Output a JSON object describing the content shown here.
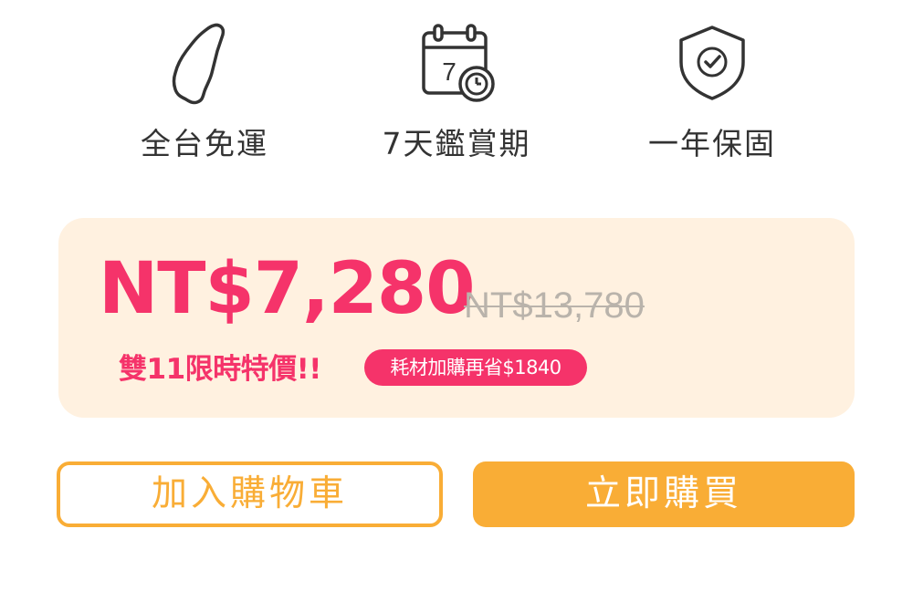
{
  "features": [
    {
      "icon": "taiwan-map-icon",
      "label": "全台免運"
    },
    {
      "icon": "calendar-clock-icon",
      "label": "7天鑑賞期",
      "icon_text": "7"
    },
    {
      "icon": "shield-check-icon",
      "label": "一年保固"
    }
  ],
  "pricing": {
    "current_price": "NT$7,280",
    "original_price": "NT$13,780",
    "promo_text": "雙11限時特價!!",
    "promo_badge": "耗材加購再省$1840"
  },
  "actions": {
    "add_to_cart_label": "加入購物車",
    "buy_now_label": "立即購買"
  },
  "colors": {
    "accent_pink": "#f5336a",
    "accent_orange": "#f9ad36",
    "card_background": "#fff1e0",
    "strikethrough_gray": "#b9b3ab"
  }
}
